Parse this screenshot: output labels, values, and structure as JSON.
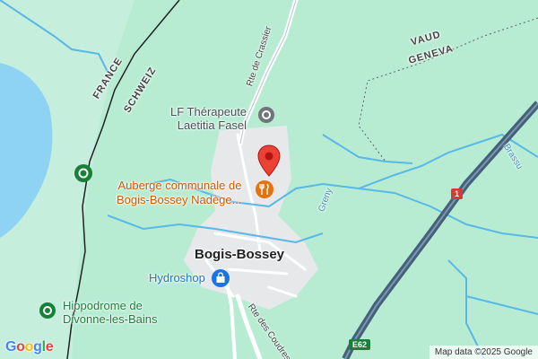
{
  "map": {
    "labels": {
      "poi_therapist": "LF Thérapeute Laetitia Fasel",
      "restaurant": "Auberge communale de Bogis-Bossey Nadège...",
      "town": "Bogis-Bossey",
      "hydroshop": "Hydroshop",
      "hippodrome": "Hippodrome de Divonne-les-Bains",
      "road_crassier": "Rte de Crassier",
      "road_coudres": "Rte des Coudres",
      "border_france": "FRANCE",
      "border_schweiz": "SCHWEIZ",
      "region_vaud": "VAUD",
      "region_geneva": "GENEVA",
      "river_greny": "Greny",
      "river_brassu": "Brassu",
      "highway_e62": "E62",
      "highway_1": "1"
    },
    "poi_therapist_lines": [
      "LF Thérapeute",
      "Laetitia Fasel"
    ],
    "restaurant_lines": [
      "Auberge communale de",
      "Bogis-Bossey Nadège..."
    ],
    "hippodrome_lines": [
      "Hippodrome de",
      "Divonne-les-Bains"
    ],
    "attribution": "Map data ©2025 Google",
    "logo": {
      "g1": "G",
      "o1": "o",
      "o2": "o",
      "g2": "g",
      "l": "l",
      "e": "e"
    },
    "colors": {
      "land": "#b7ecd3",
      "lake": "#8fd3f4",
      "river": "#58b8e6",
      "motorway": "#44607a",
      "pin": "#ea4335",
      "restaurant": "#e8710a",
      "park_marker": "#188038",
      "hydroshop": "#1a73e8"
    },
    "icons": [
      "location-pin-icon",
      "restaurant-icon",
      "park-icon",
      "shopping-bag-icon",
      "landmark-icon"
    ]
  }
}
